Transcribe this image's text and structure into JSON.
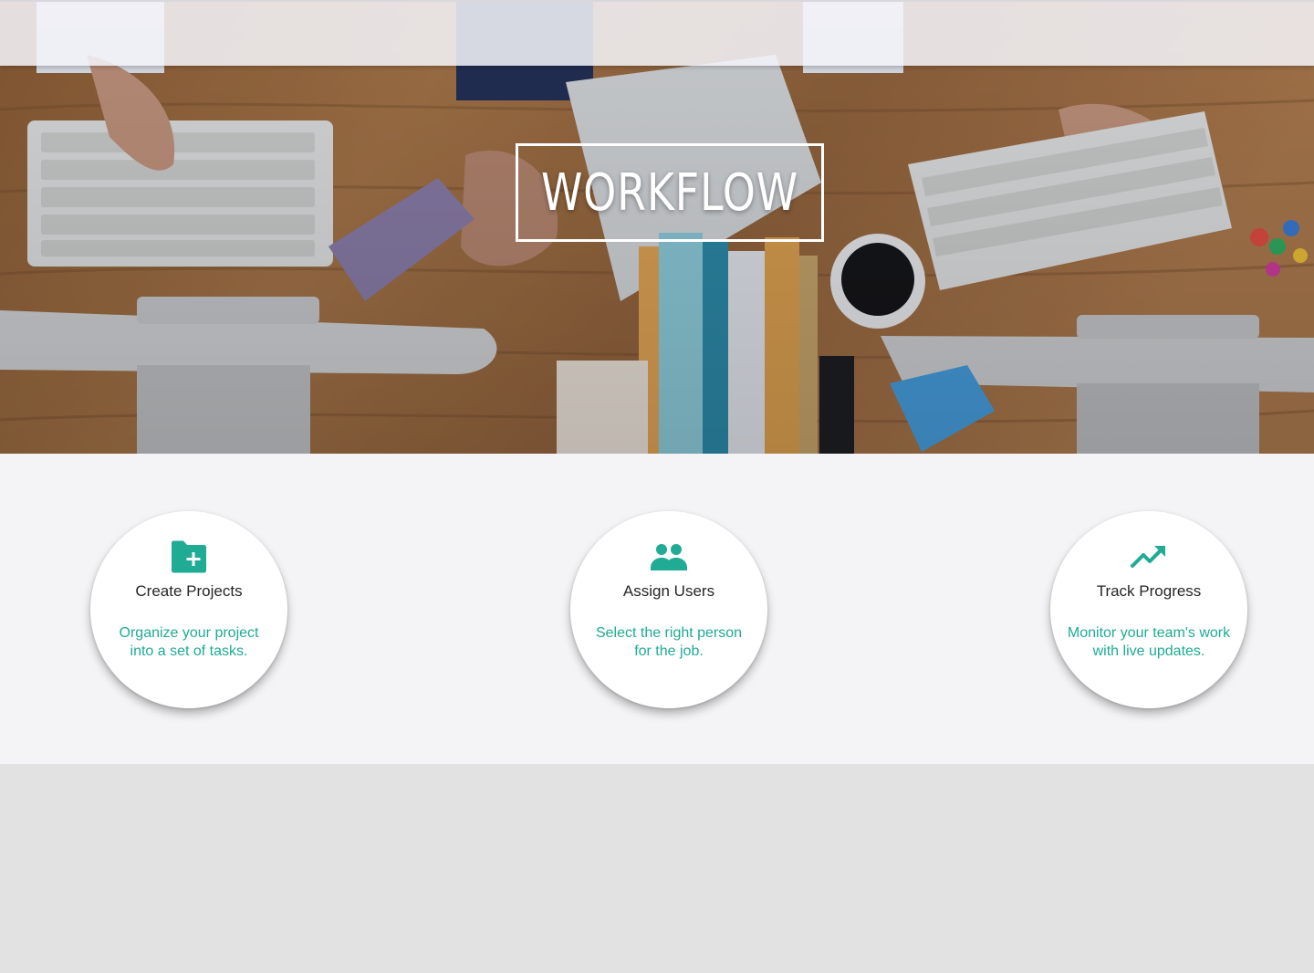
{
  "hero": {
    "title": "WORKFLOW"
  },
  "features": [
    {
      "icon": "create-folder-icon",
      "title": "Create Projects",
      "description": "Organize your project into a set of tasks."
    },
    {
      "icon": "users-icon",
      "title": "Assign Users",
      "description": "Select the right person for the job."
    },
    {
      "icon": "trending-up-icon",
      "title": "Track Progress",
      "description": "Monitor your team's work with live updates."
    }
  ],
  "colors": {
    "accent": "#1fab94",
    "title_text": "#262626",
    "section_bg": "#f4f4f6",
    "footer_bg": "#e2e2e2"
  }
}
